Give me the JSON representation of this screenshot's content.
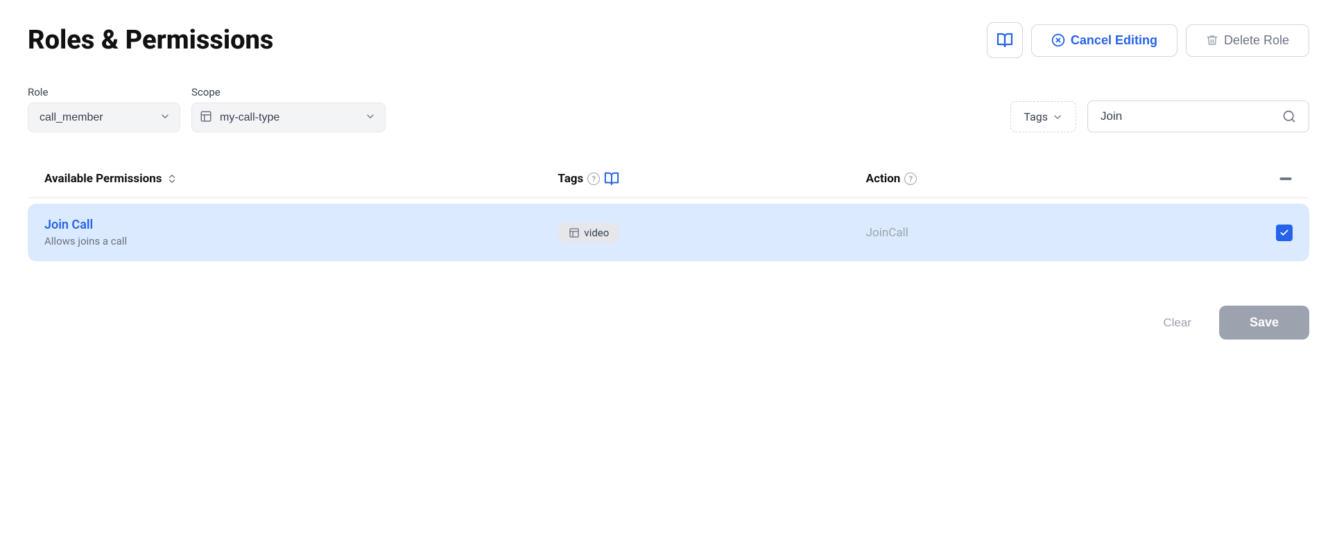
{
  "page": {
    "title": "Roles & Permissions"
  },
  "header": {
    "book_icon": "book-open-icon",
    "cancel_label": "Cancel Editing",
    "delete_label": "Delete Role"
  },
  "form": {
    "role_label": "Role",
    "role_value": "call_member",
    "scope_label": "Scope",
    "scope_value": "my-call-type",
    "tags_label": "Tags",
    "search_placeholder": "Join",
    "search_value": "Join"
  },
  "table": {
    "col_permissions": "Available Permissions",
    "col_tags": "Tags",
    "col_action": "Action",
    "permissions": [
      {
        "name": "Join Call",
        "description": "Allows joins a call",
        "tag": "video",
        "action": "JoinCall",
        "checked": true
      }
    ]
  },
  "footer": {
    "clear_label": "Clear",
    "save_label": "Save"
  }
}
